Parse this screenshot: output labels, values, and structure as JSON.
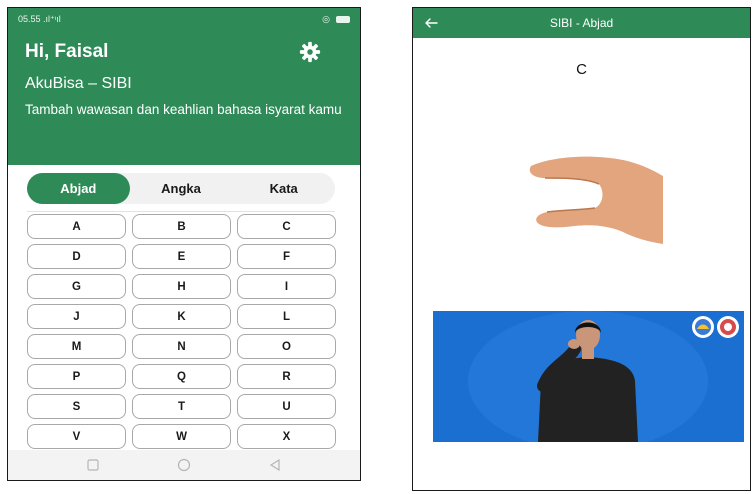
{
  "left_screen": {
    "status": {
      "time": "05.55",
      "signal_text": ".ıl⁺ᶦıl"
    },
    "greeting": "Hi,  Faisal",
    "app_title": "AkuBisa – SIBI",
    "subtitle": "Tambah wawasan dan keahlian bahasa isyarat kamu",
    "tabs": [
      {
        "label": "Abjad",
        "active": true
      },
      {
        "label": "Angka",
        "active": false
      },
      {
        "label": "Kata",
        "active": false
      }
    ],
    "letters": [
      "A",
      "B",
      "C",
      "D",
      "E",
      "F",
      "G",
      "H",
      "I",
      "J",
      "K",
      "L",
      "M",
      "N",
      "O",
      "P",
      "Q",
      "R",
      "S",
      "T",
      "U",
      "V",
      "W",
      "X"
    ],
    "nav_icons": [
      "square-nav-icon",
      "circle-nav-icon",
      "triangle-nav-icon"
    ],
    "colors": {
      "primary": "#2e8b57"
    }
  },
  "right_screen": {
    "app_bar_title": "SIBI - Abjad",
    "letter": "C",
    "colors": {
      "video_background": "#1b6fd1"
    }
  }
}
